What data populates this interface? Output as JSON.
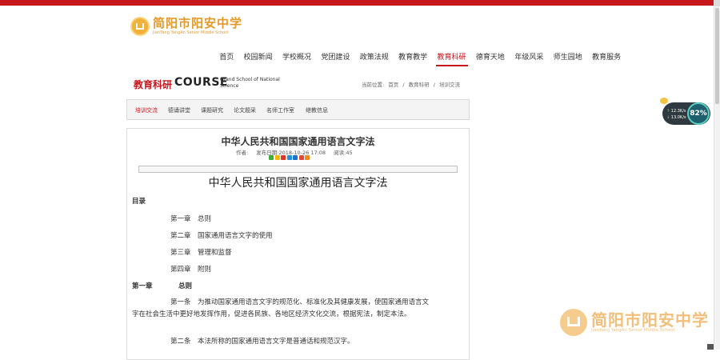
{
  "logo": {
    "name_cn": "简阳市阳安中学",
    "name_en": "JianYang YangAn Senior Middle School"
  },
  "nav": {
    "items": [
      "首页",
      "校园新闻",
      "学校概况",
      "党团建设",
      "政策法规",
      "教育教学",
      "教育科研",
      "德育天地",
      "年级风采",
      "师生园地",
      "教育服务"
    ],
    "active": "教育科研"
  },
  "section": {
    "title_cn": "教育科研",
    "title_en": "COURSE",
    "subtitle": "Grand School of National Science",
    "breadcrumb": {
      "prefix": "当前位置:",
      "items": [
        "首页",
        "教育科研",
        "培训交流"
      ],
      "separator": "/"
    }
  },
  "subnav": {
    "items": [
      "培训交流",
      "德诵讲堂",
      "课题研究",
      "论文题采",
      "名师工作室",
      "继教信息"
    ],
    "active": "培训交流"
  },
  "article": {
    "title": "中华人民共和国国家通用语言文字法",
    "author_label": "作者:",
    "date_label": "发布日期:",
    "date": "2018-10-26 17:08",
    "views_label": "阅读:",
    "views": "45"
  },
  "document": {
    "title": "中华人民共和国国家通用语言文字法",
    "toc_label": "目录",
    "toc": [
      "第一章　总则",
      "第二章　国家通用语言文字的使用",
      "第三章　管理和监督",
      "第四章　附则"
    ],
    "chapter1_label": "第一章",
    "chapter1_title": "总则",
    "art1_line1": "第一条　为推动国家通用语言文字的规范化、标准化及其健康发展，使国家通用语言文",
    "art1_line2": "字在社会生活中更好地发挥作用，促进各民族、各地区经济文化交流，根据宪法，制定本法。",
    "art2": "第二条　本法所称的国家通用语言文字是普通话和规范汉字。"
  },
  "widget": {
    "upload": "12.3K/s",
    "download": "13.0K/s",
    "percent": "82%"
  },
  "watermark": {
    "name_cn": "简阳市阳安中学",
    "name_en": "JianYang YangAn Senior Middle School"
  },
  "colors": {
    "brand_red": "#c8161d",
    "logo_gold": "#e49a2b"
  },
  "share_icons": [
    "wechat-icon",
    "qzone-icon",
    "weibo-icon",
    "tencent-weibo-icon",
    "renren-icon",
    "douban-icon",
    "more-icon"
  ]
}
